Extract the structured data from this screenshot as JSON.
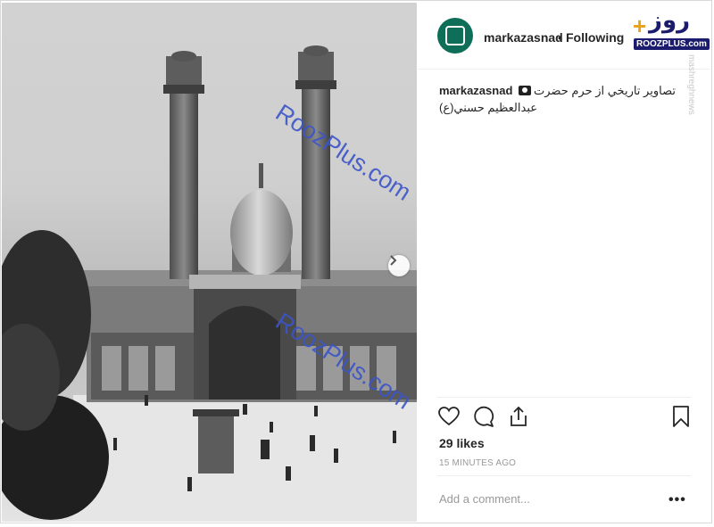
{
  "post": {
    "username": "markazasnad",
    "separator": "•",
    "follow_status": "Following",
    "caption_line1": "تصاوير تاريخي از حرم حضرت",
    "caption_line2": "عبدالعظيم حسني(ع)",
    "likes": "29 likes",
    "time": "15 MINUTES AGO",
    "add_comment_placeholder": "Add a comment...",
    "more_label": "•••"
  },
  "watermark": {
    "text1": "RoozPlus.com",
    "text2": "RoozPlus.com",
    "side_text": "mashreghnews",
    "logo_fa": "روز",
    "logo_plus": "+",
    "logo_url": "ROOZPLUS.com"
  },
  "icons": {
    "avatar": "archive-logo-icon",
    "next": "chevron-right-icon",
    "like": "heart-icon",
    "comment": "comment-icon",
    "share": "share-icon",
    "save": "bookmark-icon",
    "camera": "camera-emoji-icon"
  },
  "colors": {
    "avatar_bg": "#0f6e57",
    "watermark": "#3b55c8",
    "logo_navy": "#1c1c6e",
    "logo_orange": "#e8a21a"
  }
}
